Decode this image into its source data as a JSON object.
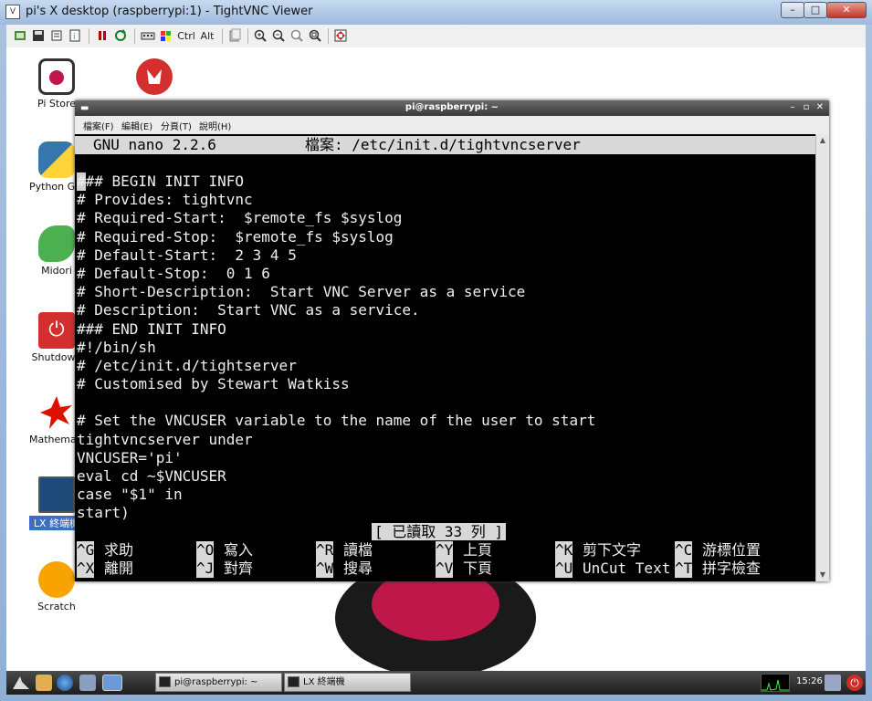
{
  "vnc": {
    "title": "pi's X desktop (raspberrypi:1) - TightVNC Viewer",
    "window_buttons": {
      "minimize": "–",
      "maximize": "□",
      "close": "✕"
    },
    "toolbar": {
      "ctrl_label": "Ctrl",
      "alt_label": "Alt"
    }
  },
  "desktop": {
    "icons": [
      {
        "label": "Pi Store",
        "icon": "pi-store-icon",
        "color": "#333333"
      },
      {
        "label": "",
        "icon": "wolfram-icon",
        "color": "#d32f2f"
      },
      {
        "label": "Python Games",
        "icon": "python-icon",
        "color": "#3776ab"
      },
      {
        "label": "Midori",
        "icon": "midori-icon",
        "color": "#4caf50"
      },
      {
        "label": "Shutdown",
        "icon": "shutdown-icon",
        "color": "#d32f2f"
      },
      {
        "label": "Mathematica",
        "icon": "mathematica-icon",
        "color": "#dd1100"
      },
      {
        "label": "LX 終端機",
        "icon": "lxterminal-icon",
        "color": "#1e4a7a"
      },
      {
        "label": "Scratch",
        "icon": "scratch-icon",
        "color": "#f7a400"
      }
    ]
  },
  "terminal": {
    "title": "pi@raspberrypi: ~",
    "menu": [
      "檔案(F)",
      "編輯(E)",
      "分頁(T)",
      "說明(H)"
    ],
    "nano": {
      "version": "GNU nano 2.2.6",
      "file_label": "檔案: /etc/init.d/tightvncserver",
      "lines": [
        "### BEGIN INIT INFO",
        "# Provides: tightvnc",
        "# Required-Start:  $remote_fs $syslog",
        "# Required-Stop:  $remote_fs $syslog",
        "# Default-Start:  2 3 4 5",
        "# Default-Stop:  0 1 6",
        "# Short-Description:  Start VNC Server as a service",
        "# Description:  Start VNC as a service.",
        "### END INIT INFO",
        "#!/bin/sh",
        "# /etc/init.d/tightserver",
        "# Customised by Stewart Watkiss",
        "",
        "# Set the VNCUSER variable to the name of the user to start",
        "tightvncserver under",
        "VNCUSER='pi'",
        "eval cd ~$VNCUSER",
        "case \"$1\" in",
        "start)"
      ],
      "status": "[ 已讀取 33 列 ]",
      "shortcuts_row1": [
        {
          "key": "^G",
          "label": "求助"
        },
        {
          "key": "^O",
          "label": "寫入"
        },
        {
          "key": "^R",
          "label": "讀檔"
        },
        {
          "key": "^Y",
          "label": "上頁"
        },
        {
          "key": "^K",
          "label": "剪下文字"
        },
        {
          "key": "^C",
          "label": "游標位置"
        }
      ],
      "shortcuts_row2": [
        {
          "key": "^X",
          "label": "離開"
        },
        {
          "key": "^J",
          "label": "對齊"
        },
        {
          "key": "^W",
          "label": "搜尋"
        },
        {
          "key": "^V",
          "label": "下頁"
        },
        {
          "key": "^U",
          "label": "UnCut Text"
        },
        {
          "key": "^T",
          "label": "拼字檢查"
        }
      ]
    }
  },
  "taskbar": {
    "tasks": [
      {
        "label": "pi@raspberrypi: ~"
      },
      {
        "label": "LX 終端機"
      }
    ],
    "clock": "15:26"
  }
}
